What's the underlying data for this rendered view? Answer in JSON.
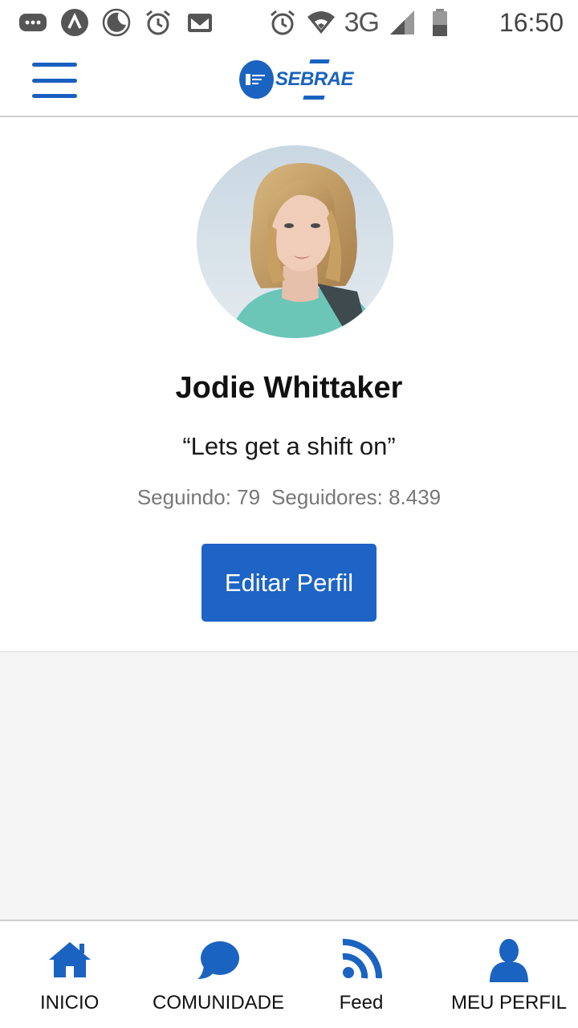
{
  "status_bar": {
    "icons_left": [
      "more-notifications-icon",
      "app-icon",
      "do-not-disturb-icon",
      "alarm-icon",
      "gmail-icon"
    ],
    "icons_right": [
      "alarm-icon",
      "wifi-icon",
      "signal-icon",
      "battery-icon"
    ],
    "network": "3G",
    "time": "16:50"
  },
  "appbar": {
    "menu_icon": "hamburger-menu-icon",
    "logo_text": "SEBRAE"
  },
  "profile": {
    "name": "Jodie Whittaker",
    "quote": "“Lets get a shift on”",
    "following": "Seguindo: 79",
    "followers": "Seguidores: 8.439",
    "edit_button": "Editar Perfil"
  },
  "bottom_nav": {
    "items": [
      {
        "label": "INICIO",
        "icon": "home-icon"
      },
      {
        "label": "COMUNIDADE",
        "icon": "chat-bubble-icon"
      },
      {
        "label": "Feed",
        "icon": "rss-feed-icon"
      },
      {
        "label": "MEU PERFIL",
        "icon": "user-icon"
      }
    ]
  },
  "colors": {
    "brand": "#1a63c0",
    "button": "#1e63c6",
    "content_bg": "#f5f5f5"
  }
}
